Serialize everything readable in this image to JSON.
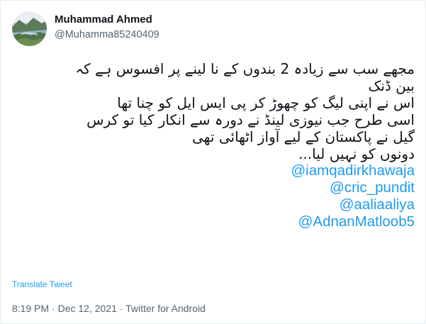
{
  "tweet": {
    "author": {
      "display_name": "Muhammad Ahmed",
      "handle": "@Muhamma85240409",
      "avatar_icon": "landscape-avatar-icon"
    },
    "body_lines": [
      "مجھے سب سے زیادہ 2 بندوں کے نا لینے  پر افسوس ہے کہ",
      "بین ڈنک",
      "اس نے اپنی لیگ کو چھوڑ کر پی ایس ایل کو چنا تھا",
      "اسی طرح جب نیوزی لینڈ نے دورہ سے انکار کیا تو کرس",
      "گیل نے پاکستان کے لیے آواز اٹھائی تھی",
      "دونوں کو نہیں لیا..."
    ],
    "mentions": [
      "@iamqadirkhawaja",
      "@cric_pundit",
      "@aaliaaliya",
      "@AdnanMatloob5"
    ],
    "translate_label": "Translate Tweet",
    "time": "8:19 PM",
    "date": "Dec 12, 2021",
    "source": "Twitter for Android",
    "separator": "·"
  },
  "colors": {
    "accent": "#1d9bf0",
    "text_primary": "#0f1419",
    "text_secondary": "#536471",
    "border": "#e6ecf0"
  }
}
